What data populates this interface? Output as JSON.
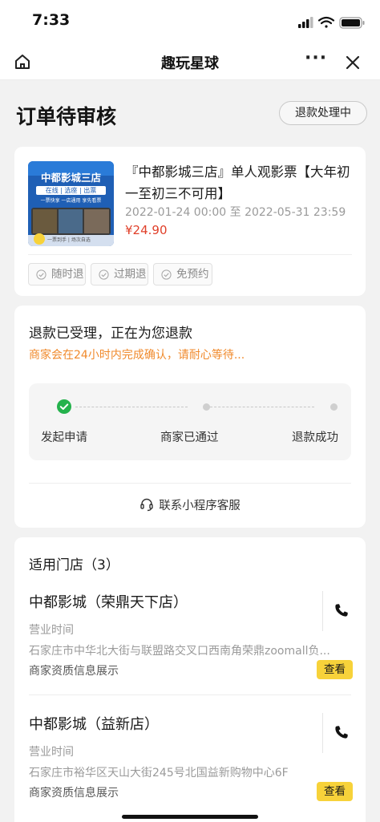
{
  "status_bar": {
    "time": "7:33"
  },
  "nav": {
    "title": "趣玩星球",
    "more_label": "···"
  },
  "header": {
    "title": "订单待审核",
    "refund_status_button": "退款处理中"
  },
  "product": {
    "title": "『中都影城三店』单人观影票【大年初一至初三不可用】",
    "date_start": "2022-01-24 00:00",
    "date_sep": "至",
    "date_end": "2022-05-31 23:59",
    "price": "¥24.90",
    "thumb": {
      "headline": "中都影城三店",
      "tags_line": "在线 | 选座 | 出票",
      "sub_line": "一票快享 一店通用 享先看票",
      "bottom_line": "一票到手 | 场次自选"
    },
    "tags": [
      "随时退",
      "过期退",
      "免预约"
    ]
  },
  "refund": {
    "heading": "退款已受理，正在为您退款",
    "notice": "商家会在24小时内完成确认，请耐心等待...",
    "steps": [
      {
        "label": "发起申请",
        "done": true
      },
      {
        "label": "商家已通过",
        "done": false
      },
      {
        "label": "退款成功",
        "done": false
      }
    ],
    "support_label": "联系小程序客服"
  },
  "stores": {
    "heading": "适用门店（3）",
    "items": [
      {
        "name": "中都影城（荣鼎天下店）",
        "hours_label": "营业时间",
        "address": "石家庄市中华北大街与联盟路交叉口西南角荣鼎zoomall负...",
        "license_label": "商家资质信息展示",
        "view_button": "查看"
      },
      {
        "name": "中都影城（益新店）",
        "hours_label": "营业时间",
        "address": "石家庄市裕华区天山大街245号北国益新购物中心6F",
        "license_label": "商家资质信息展示",
        "view_button": "查看"
      }
    ]
  },
  "colors": {
    "price": "#e0402a",
    "notice": "#f08a2c",
    "step_done": "#24b24c",
    "view_button": "#f7d23a"
  }
}
